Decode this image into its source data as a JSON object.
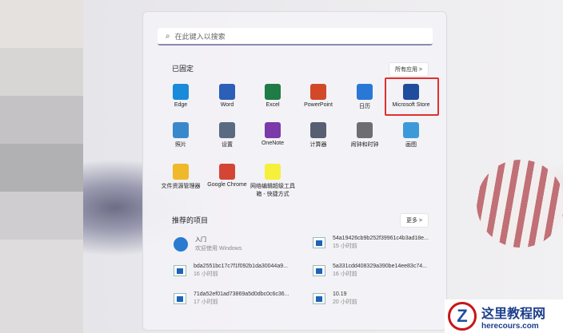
{
  "search": {
    "placeholder": "在此键入以搜索"
  },
  "pinned": {
    "title": "已固定",
    "all_apps": "所有应用  >",
    "apps": [
      {
        "label": "Edge",
        "color": "#1a8bd8"
      },
      {
        "label": "Word",
        "color": "#2b5fb8"
      },
      {
        "label": "Excel",
        "color": "#1e7c44"
      },
      {
        "label": "PowerPoint",
        "color": "#d2492a"
      },
      {
        "label": "日历",
        "color": "#2a78d6"
      },
      {
        "label": "Microsoft Store",
        "color": "#1f4c9c"
      },
      {
        "label": "照片",
        "color": "#3a88cc"
      },
      {
        "label": "设置",
        "color": "#5a6a80"
      },
      {
        "label": "OneNote",
        "color": "#7a3aaa"
      },
      {
        "label": "计算器",
        "color": "#566070"
      },
      {
        "label": "闹钟和时钟",
        "color": "#6d6d72"
      },
      {
        "label": "画图",
        "color": "#3d9ad8"
      },
      {
        "label": "文件资源管理器",
        "color": "#f0b92a"
      },
      {
        "label": "Google Chrome",
        "color": "#d44536"
      },
      {
        "label": "网络编辑超级工具箱 - 快捷方式",
        "color": "#f5f03a"
      }
    ]
  },
  "recommended": {
    "title": "推荐的项目",
    "more": "更多  >",
    "items": [
      {
        "name": "入门",
        "sub": "欢迎使用 Windows"
      },
      {
        "name": "54a19426cb9b252f39961c4b3ad18e...",
        "sub": "15 小时前"
      },
      {
        "name": "bda2551bc17c7f1f092b1da30044a9...",
        "sub": "16 小时前"
      },
      {
        "name": "5a331cdd408329a390be14ee83c74...",
        "sub": "16 小时前"
      },
      {
        "name": "71da52ef01ad73869a5d0dbc0c6c36...",
        "sub": "17 小时前"
      },
      {
        "name": "10.19",
        "sub": "20 小时前"
      }
    ]
  },
  "watermark": {
    "title": "这里教程网",
    "url": "herecours.com"
  }
}
